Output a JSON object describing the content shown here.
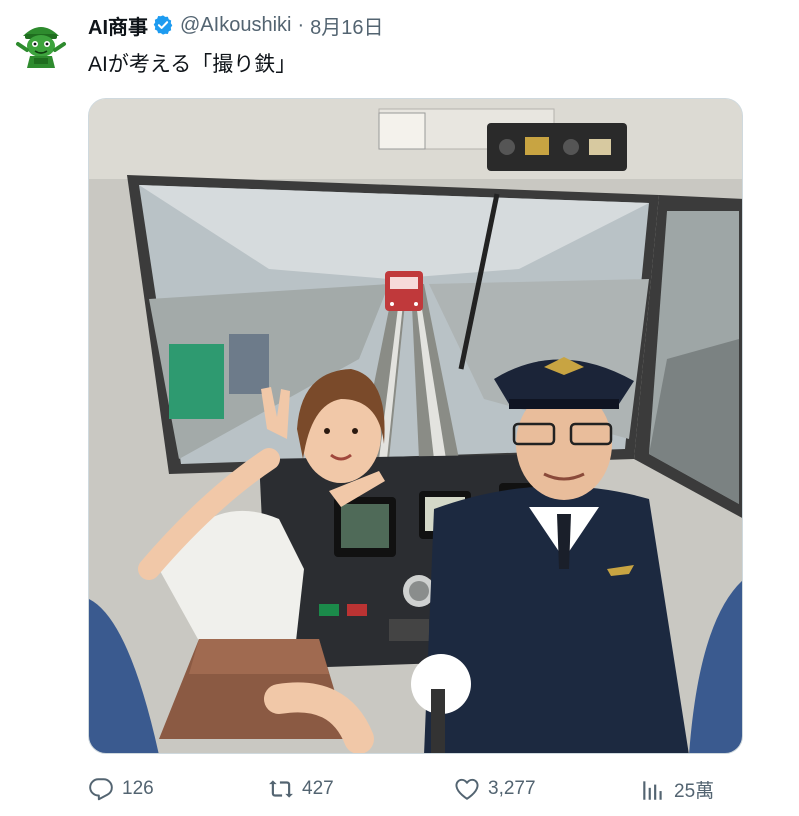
{
  "tweet": {
    "display_name": "AI商事",
    "handle": "@AIkoushiki",
    "separator": "·",
    "date": "8月16日",
    "text": "AIが考える「撮り鉄」"
  },
  "media": {
    "description_icon": "photo"
  },
  "actions": {
    "reply_count": "126",
    "retweet_count": "427",
    "like_count": "3,277",
    "view_count": "25萬"
  },
  "colors": {
    "verified": "#1d9bf0",
    "secondary_text": "#536471",
    "avatar_green": "#2e8b2e"
  },
  "icons": {
    "reply": "speech-bubble-icon",
    "retweet": "retweet-icon",
    "like": "heart-icon",
    "views": "bar-chart-icon",
    "verified": "verified-badge-icon"
  }
}
